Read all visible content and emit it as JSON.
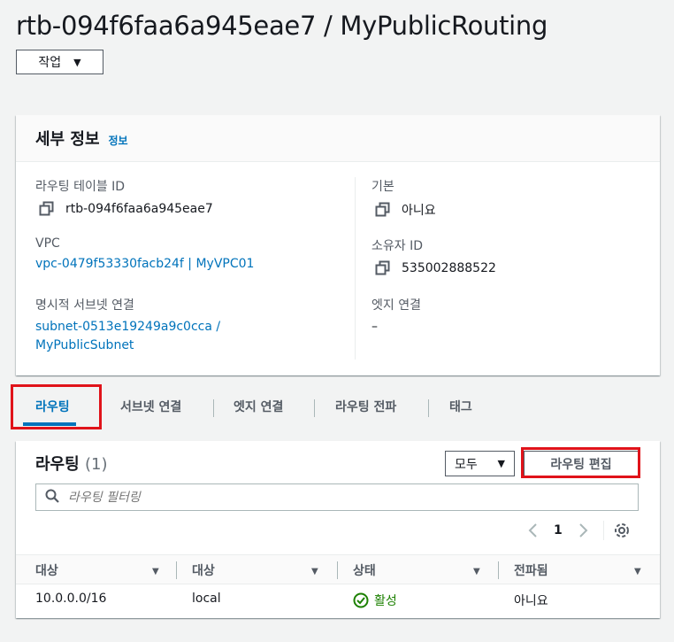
{
  "page": {
    "title": "rtb-094f6faa6a945eae7 / MyPublicRouting",
    "actions_label": "작업"
  },
  "details": {
    "title": "세부 정보",
    "info_link": "정보",
    "fields": {
      "route_table_id": {
        "label": "라우팅 테이블 ID",
        "value": "rtb-094f6faa6a945eae7"
      },
      "main": {
        "label": "기본",
        "value": "아니요"
      },
      "vpc": {
        "label": "VPC",
        "value": "vpc-0479f53330facb24f | MyVPC01"
      },
      "owner_id": {
        "label": "소유자 ID",
        "value": "535002888522"
      },
      "explicit_subnet": {
        "label": "명시적 서브넷 연결",
        "value_line1": "subnet-0513e19249a9c0cca /",
        "value_line2": "MyPublicSubnet"
      },
      "edge_assoc": {
        "label": "엣지 연결",
        "value": "–"
      }
    }
  },
  "tabs": [
    {
      "label": "라우팅",
      "active": true
    },
    {
      "label": "서브넷 연결",
      "active": false
    },
    {
      "label": "엣지 연결",
      "active": false
    },
    {
      "label": "라우팅 전파",
      "active": false
    },
    {
      "label": "태그",
      "active": false
    }
  ],
  "routes": {
    "title": "라우팅",
    "count": "(1)",
    "filter_select": "모두",
    "edit_button": "라우팅 편집",
    "search_placeholder": "라우팅 필터링",
    "page": "1",
    "columns": [
      "대상",
      "대상",
      "상태",
      "전파됨"
    ],
    "rows": [
      {
        "destination": "10.0.0.0/16",
        "target": "local",
        "status": "활성",
        "propagated": "아니요"
      }
    ]
  },
  "colors": {
    "link": "#0073bb",
    "highlight": "#e0131a",
    "success": "#1d8102"
  }
}
